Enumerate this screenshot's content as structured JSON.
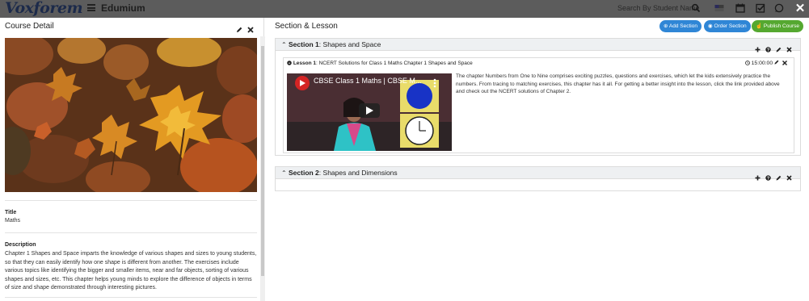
{
  "app": {
    "logo": "Voxforem",
    "name": "Edumium",
    "search_placeholder": "Search By Student Name"
  },
  "icons": {
    "menu": "hamburger-icon",
    "search": "search-icon",
    "flag": "flag-icon",
    "calendar": "calendar-icon",
    "tasks": "checklist-icon",
    "chat": "whatsapp-icon",
    "notifications": "bell-icon",
    "close": "close-icon"
  },
  "colors": {
    "accent_blue": "#2f86d6",
    "accent_green": "#55a830",
    "topbar": "#5c5c5c"
  },
  "course_detail": {
    "heading": "Course Detail",
    "title_label": "Title",
    "title_value": "Maths",
    "description_label": "Description",
    "description_value": "Chapter 1 Shapes and Space imparts the knowledge of various shapes and sizes to young students, so that they can easily identify how one shape is different from another. The exercises include various topics like identifying the bigger and smaller items, near and far objects, sorting of various shapes and sizes, etc. This chapter helps young minds to explore the difference of objects in terms of size and shape demonstrated through interesting pictures."
  },
  "section_lesson": {
    "heading": "Section & Lesson",
    "buttons": {
      "add_section": "Add Section",
      "order_section": "Order Section",
      "publish_course": "Publish Course"
    },
    "sections": [
      {
        "number_label": "Section 1",
        "name": ": Shapes and Space",
        "lessons": [
          {
            "number_label": "Lesson 1",
            "name": ": NCERT Solutions for Class 1 Maths Chapter 1 Shapes and Space",
            "duration": "15:00:00",
            "video_title": "CBSE Class 1 Maths | CBSE M...",
            "description": "The chapter Numbers from One to Nine comprises exciting puzzles, questions and exercises, which let the kids extensively practice the numbers. From tracing to matching exercises, this chapter has it all. For getting a better insight into the lesson, click the link provided above and check out the NCERT solutions of Chapter 2."
          }
        ]
      },
      {
        "number_label": "Section 2",
        "name": ": Shapes and Dimensions",
        "lessons": []
      }
    ]
  }
}
